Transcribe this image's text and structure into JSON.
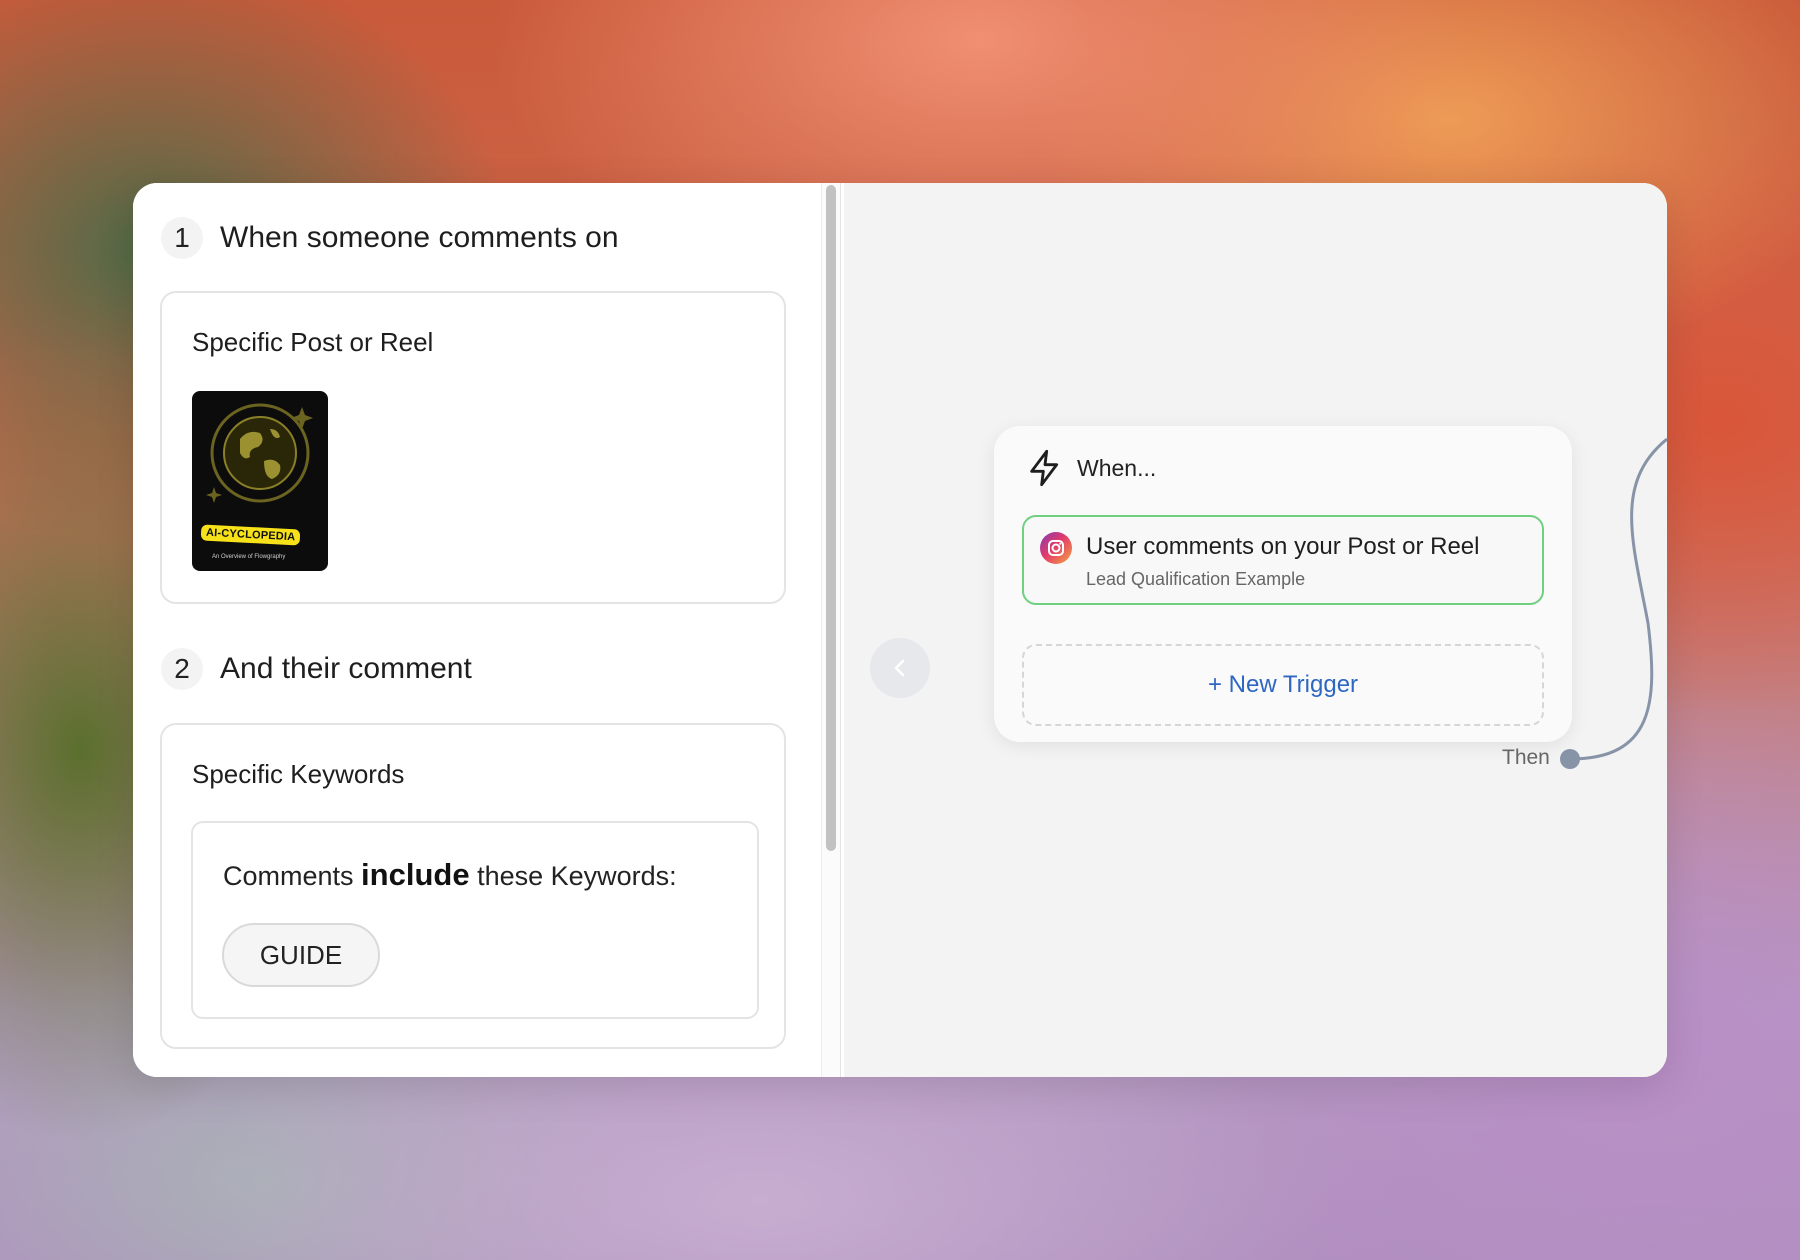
{
  "left": {
    "step1": {
      "number": "1",
      "title": "When someone comments on"
    },
    "card1": {
      "title": "Specific Post or Reel",
      "thumbnail_label": "AI-CYCLOPEDIA",
      "thumbnail_sub": "An Overview of Flowgraphy"
    },
    "step2": {
      "number": "2",
      "title": "And their comment"
    },
    "card2": {
      "title": "Specific Keywords",
      "keywords_prefix": "Comments",
      "keywords_bold": "include",
      "keywords_suffix": "these Keywords:",
      "keywords": [
        "GUIDE"
      ]
    }
  },
  "canvas": {
    "node": {
      "title": "When...",
      "trigger": {
        "title": "User comments on your Post or Reel",
        "subtitle": "Lead Qualification Example"
      },
      "new_trigger_label": "+ New Trigger",
      "then_label": "Then"
    }
  },
  "colors": {
    "trigger_border": "#6fd07f",
    "link_blue": "#2d67c2",
    "connector": "#8794a8"
  },
  "icons": {
    "collapse": "chevron-left-icon",
    "trigger": "lightning-icon",
    "platform": "instagram-icon"
  }
}
